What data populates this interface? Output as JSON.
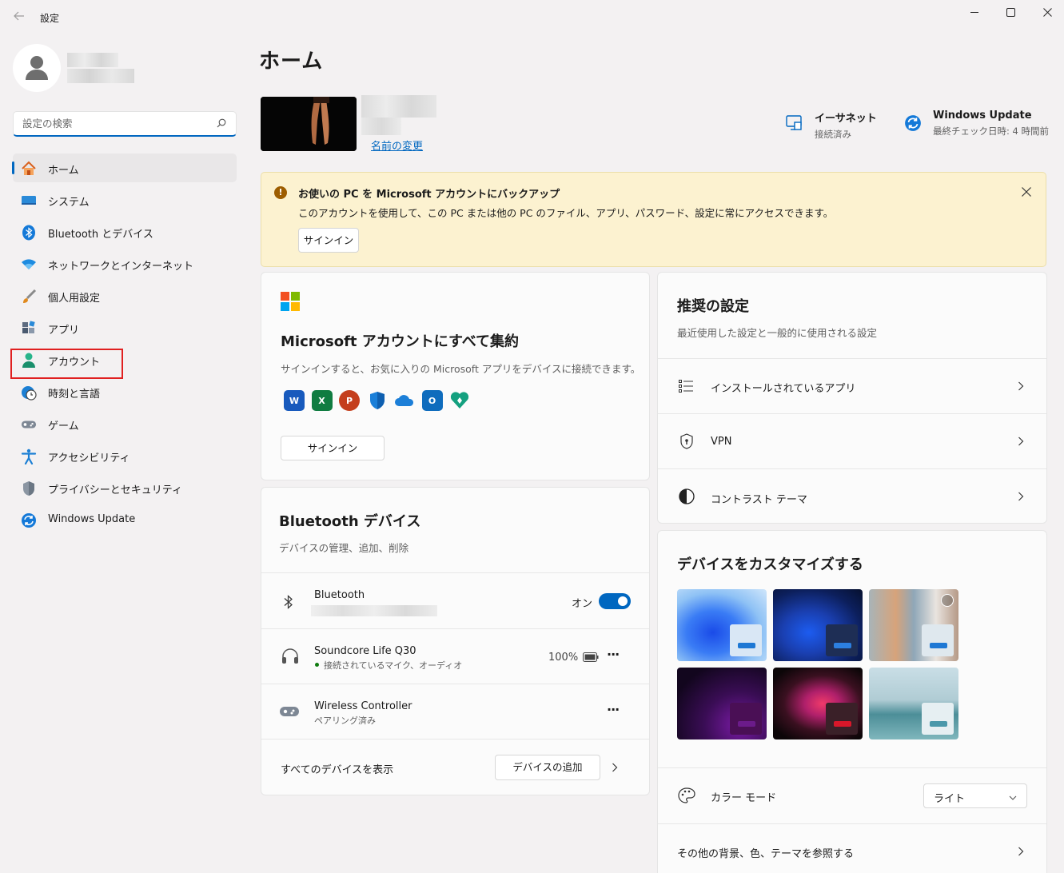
{
  "window": {
    "title": "設定"
  },
  "search": {
    "placeholder": "設定の検索"
  },
  "sidebar": {
    "items": [
      {
        "label": "ホーム"
      },
      {
        "label": "システム"
      },
      {
        "label": "Bluetooth とデバイス"
      },
      {
        "label": "ネットワークとインターネット"
      },
      {
        "label": "個人用設定"
      },
      {
        "label": "アプリ"
      },
      {
        "label": "アカウント"
      },
      {
        "label": "時刻と言語"
      },
      {
        "label": "ゲーム"
      },
      {
        "label": "アクセシビリティ"
      },
      {
        "label": "プライバシーとセキュリティ"
      },
      {
        "label": "Windows Update"
      }
    ]
  },
  "main": {
    "title": "ホーム",
    "rename_link": "名前の変更",
    "ethernet": {
      "title": "イーサネット",
      "sub": "接続済み"
    },
    "update": {
      "title": "Windows Update",
      "sub": "最終チェック日時: 4 時間前"
    }
  },
  "banner": {
    "title": "お使いの PC を Microsoft アカウントにバックアップ",
    "text": "このアカウントを使用して、この PC または他の PC のファイル、アプリ、パスワード、設定に常にアクセスできます。",
    "button": "サインイン"
  },
  "ms_card": {
    "title": "Microsoft アカウントにすべて集約",
    "sub": "サインインすると、お気に入りの Microsoft アプリをデバイスに接続できます。",
    "button": "サインイン",
    "apps": [
      "W",
      "X",
      "P",
      "",
      "",
      "O",
      ""
    ]
  },
  "bt_card": {
    "title": "Bluetooth デバイス",
    "sub": "デバイスの管理、追加、削除",
    "bluetooth": {
      "label": "Bluetooth",
      "state": "オン"
    },
    "devices": [
      {
        "name": "Soundcore Life Q30",
        "status": "接続されているマイク、オーディオ",
        "battery": "100%"
      },
      {
        "name": "Wireless Controller",
        "status": "ペアリング済み"
      }
    ],
    "show_all": "すべてのデバイスを表示",
    "add_button": "デバイスの追加",
    "more": "···"
  },
  "rec_card": {
    "title": "推奨の設定",
    "sub": "最近使用した設定と一般的に使用される設定",
    "items": [
      {
        "label": "インストールされているアプリ"
      },
      {
        "label": "VPN"
      },
      {
        "label": "コントラスト テーマ"
      }
    ]
  },
  "cust_card": {
    "title": "デバイスをカスタマイズする",
    "color_mode": {
      "label": "カラー モード",
      "value": "ライト"
    },
    "browse": "その他の背景、色、テーマを参照する"
  }
}
